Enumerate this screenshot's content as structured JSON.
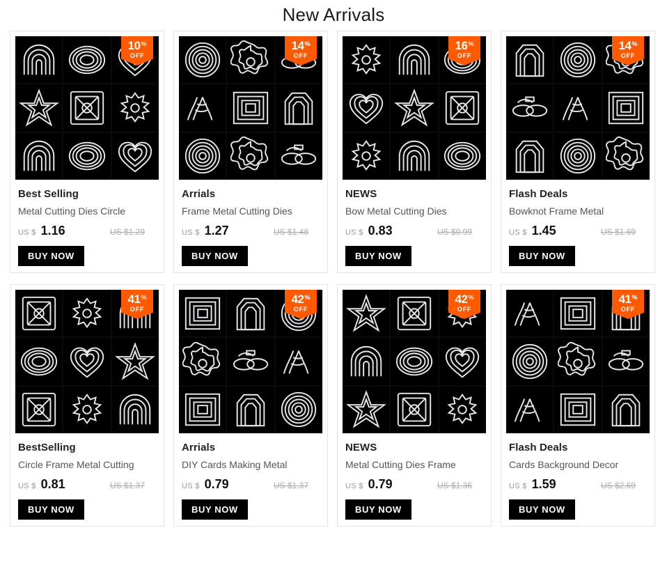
{
  "header": {
    "title": "New Arrivals"
  },
  "labels": {
    "currency": "US $",
    "percent_symbol": "%",
    "off_text": "OFF",
    "buy_label": "BUY NOW"
  },
  "colors": {
    "badge": "#ff5a00",
    "button": "#000000",
    "price": "#111111",
    "old_price": "#aaaaaa"
  },
  "products": [
    {
      "category": "Best Selling",
      "description": "Metal Cutting Dies Circle",
      "currency": "US $",
      "price": "1.16",
      "old_price": "US $1.29",
      "discount": "10",
      "buy_label": "BUY NOW"
    },
    {
      "category": "Arrials",
      "description": "Frame Metal Cutting Dies",
      "currency": "US $",
      "price": "1.27",
      "old_price": "US $1.48",
      "discount": "14",
      "buy_label": "BUY NOW"
    },
    {
      "category": "NEWS",
      "description": "Bow Metal Cutting Dies",
      "currency": "US $",
      "price": "0.83",
      "old_price": "US $0.99",
      "discount": "16",
      "buy_label": "BUY NOW"
    },
    {
      "category": "Flash Deals",
      "description": "Bowknot Frame Metal",
      "currency": "US $",
      "price": "1.45",
      "old_price": "US $1.69",
      "discount": "14",
      "buy_label": "BUY NOW"
    },
    {
      "category": "BestSelling",
      "description": "Circle Frame Metal Cutting",
      "currency": "US $",
      "price": "0.81",
      "old_price": "US $1.37",
      "discount": "41",
      "buy_label": "BUY NOW"
    },
    {
      "category": "Arrials",
      "description": "DIY Cards Making Metal",
      "currency": "US $",
      "price": "0.79",
      "old_price": "US $1.37",
      "discount": "42",
      "buy_label": "BUY NOW"
    },
    {
      "category": "NEWS",
      "description": "Metal Cutting Dies Frame",
      "currency": "US $",
      "price": "0.79",
      "old_price": "US $1.36",
      "discount": "42",
      "buy_label": "BUY NOW"
    },
    {
      "category": "Flash Deals",
      "description": "Cards Background Decor",
      "currency": "US $",
      "price": "1.59",
      "old_price": "US $2.69",
      "discount": "41",
      "buy_label": "BUY NOW"
    }
  ]
}
